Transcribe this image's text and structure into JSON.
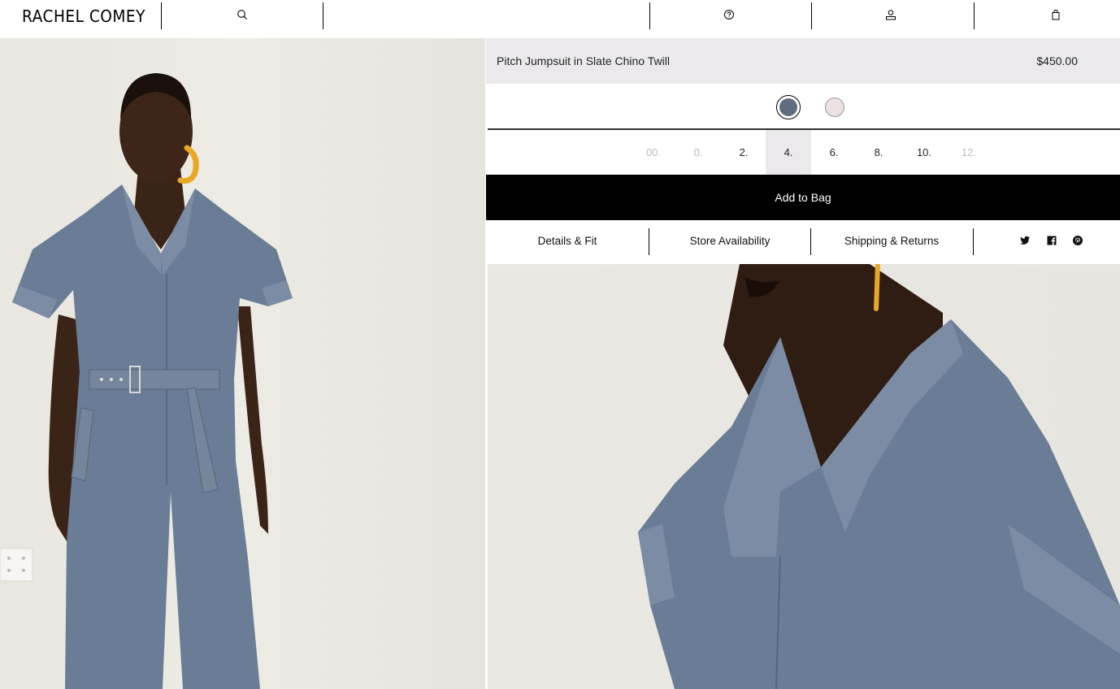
{
  "header": {
    "logo": "RACHEL COMEY",
    "icons": [
      "search-icon",
      "help-icon",
      "account-icon",
      "bag-icon"
    ]
  },
  "product": {
    "name": "Pitch Jumpsuit in Slate Chino Twill",
    "price": "$450.00",
    "colors": [
      {
        "name": "slate",
        "hex": "#5f6d80",
        "selected": true
      },
      {
        "name": "blush",
        "hex": "#ebe1e1",
        "selected": false
      }
    ],
    "sizes": [
      {
        "label": "00.",
        "available": false,
        "active": false
      },
      {
        "label": "0.",
        "available": false,
        "active": false
      },
      {
        "label": "2.",
        "available": true,
        "active": false
      },
      {
        "label": "4.",
        "available": true,
        "active": true
      },
      {
        "label": "6.",
        "available": true,
        "active": false
      },
      {
        "label": "8.",
        "available": true,
        "active": false
      },
      {
        "label": "10.",
        "available": true,
        "active": false
      },
      {
        "label": "12.",
        "available": false,
        "active": false
      }
    ],
    "add_to_bag": "Add to Bag"
  },
  "tabs": {
    "details": "Details & Fit",
    "store": "Store Availability",
    "shipping": "Shipping & Returns"
  },
  "social": [
    "twitter-icon",
    "facebook-icon",
    "pinterest-icon"
  ],
  "colors": {
    "accent": "#000000",
    "panel_bg": "#ebe9ec",
    "jumpsuit": "#6b7d96",
    "earring": "#e9a824"
  }
}
